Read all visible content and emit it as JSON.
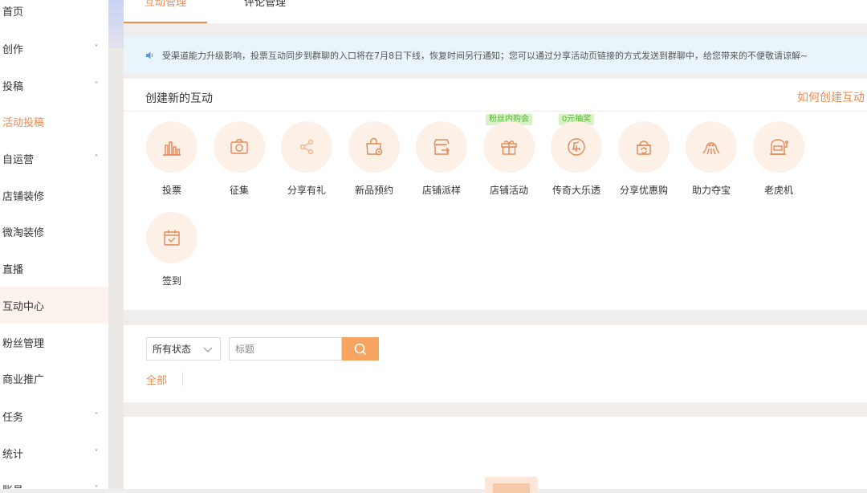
{
  "sidebar": {
    "items": [
      {
        "label": "首页",
        "chevron": ""
      },
      {
        "label": "创作",
        "chevron": "˅"
      },
      {
        "label": "投稿",
        "chevron": "˄"
      },
      {
        "label": "活动投稿",
        "chevron": ""
      },
      {
        "label": "自运营",
        "chevron": "˄"
      },
      {
        "label": "店铺装修",
        "chevron": ""
      },
      {
        "label": "微淘装修",
        "chevron": ""
      },
      {
        "label": "直播",
        "chevron": ""
      },
      {
        "label": "互动中心",
        "chevron": ""
      },
      {
        "label": "粉丝管理",
        "chevron": ""
      },
      {
        "label": "商业推广",
        "chevron": ""
      },
      {
        "label": "任务",
        "chevron": "˅"
      },
      {
        "label": "统计",
        "chevron": "˅"
      },
      {
        "label": "账号",
        "chevron": "˅"
      }
    ]
  },
  "tabs": {
    "interaction": "互动管理",
    "comments": "评论管理"
  },
  "notice": {
    "text": "受渠道能力升级影响，投票互动同步到群聊的入口将在7月8日下线，恢复时间另行通知；您可以通过分享活动页链接的方式发送到群聊中，给您带来的不便敬请谅解~"
  },
  "create": {
    "title": "创建新的互动",
    "help_link": "如何创建互动",
    "activities": [
      {
        "name": "投票",
        "icon": "bar-chart-icon",
        "badge": ""
      },
      {
        "name": "征集",
        "icon": "camera-icon",
        "badge": ""
      },
      {
        "name": "分享有礼",
        "icon": "share-icon",
        "badge": ""
      },
      {
        "name": "新品预约",
        "icon": "bag-clock-icon",
        "badge": ""
      },
      {
        "name": "店铺派样",
        "icon": "shop-sample-icon",
        "badge": ""
      },
      {
        "name": "店铺活动",
        "icon": "gift-icon",
        "badge": "粉丝内购会"
      },
      {
        "name": "传奇大乐透",
        "icon": "lottery-icon",
        "badge": "0元抽奖"
      },
      {
        "name": "分享优惠购",
        "icon": "basket-share-icon",
        "badge": ""
      },
      {
        "name": "助力夺宝",
        "icon": "octopus-icon",
        "badge": ""
      },
      {
        "name": "老虎机",
        "icon": "slot-machine-icon",
        "badge": ""
      },
      {
        "name": "签到",
        "icon": "calendar-check-icon",
        "badge": ""
      }
    ]
  },
  "filter": {
    "status_selected": "所有状态",
    "title_placeholder": "标题",
    "tab_all": "全部"
  },
  "colors": {
    "accent": "#f08b4e",
    "icon_bg": "#fdf0e7",
    "badge_bg": "#d7f3c6",
    "badge_text": "#59b33b",
    "notice_bg": "#e9f4fb"
  }
}
